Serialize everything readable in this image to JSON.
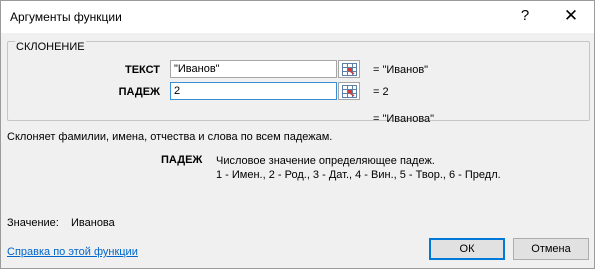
{
  "window": {
    "title": "Аргументы функции",
    "help_glyph": "?",
    "close_glyph": "✕"
  },
  "group": {
    "label": "СКЛОНЕНИЕ",
    "args": [
      {
        "label": "ТЕКСТ",
        "value": "\"Иванов\"",
        "result": "\"Иванов\""
      },
      {
        "label": "ПАДЕЖ",
        "value": "2",
        "result": "2"
      }
    ]
  },
  "formula_result": "\"Иванова\"",
  "description": "Склоняет фамилии, имена, отчества и слова по всем падежам.",
  "parameter_help": {
    "name": "ПАДЕЖ",
    "line1": "Числовое значение определяющее падеж.",
    "line2": "1 - Имен., 2 - Род., 3 - Дат., 4 - Вин., 5 - Твор., 6 - Предл."
  },
  "value": {
    "label": "Значение:",
    "text": "Иванова"
  },
  "help_link": "Справка по этой функции",
  "buttons": {
    "ok": "ОК",
    "cancel": "Отмена"
  },
  "icons": {
    "help": "help-icon",
    "close": "close-icon",
    "ref": "range-select-icon"
  },
  "colors": {
    "link": "#0066cc",
    "default_button_border": "#0078d7",
    "focused_input_border": "#3b8dd6"
  }
}
